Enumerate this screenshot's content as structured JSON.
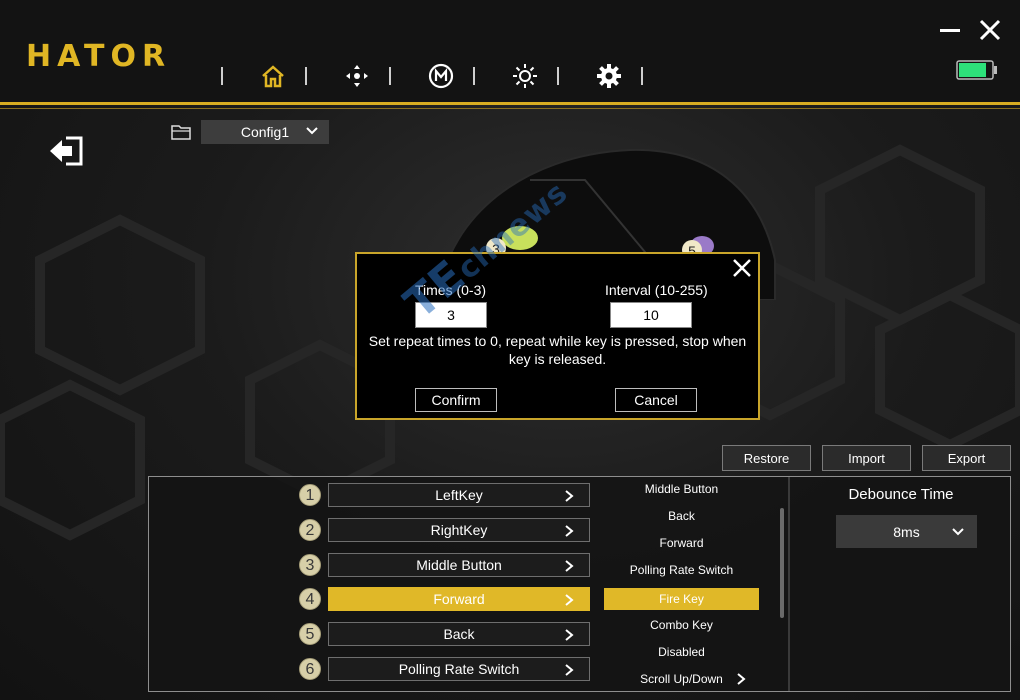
{
  "app": {
    "logo_text": "HATOR"
  },
  "nav": {
    "icons": [
      "home-icon",
      "directional-pad-icon",
      "macro-icon",
      "lighting-icon",
      "settings-icon"
    ],
    "active": "home-icon",
    "active_color": "#e0b624"
  },
  "window": {
    "minimize_icon": "minimize-icon",
    "close_icon": "close-icon",
    "battery_color": "#2de07a"
  },
  "config": {
    "selected": "Config1"
  },
  "dialog": {
    "times_label": "Times (0-3)",
    "times_value": "3",
    "interval_label": "Interval (10-255)",
    "interval_value": "10",
    "message_line1": "Set repeat times to 0, repeat while key is pressed, stop when",
    "message_line2": "key is released.",
    "confirm_label": "Confirm",
    "cancel_label": "Cancel"
  },
  "watermark": {
    "text": "TE",
    "suffix": "chnews"
  },
  "actions": {
    "restore": "Restore",
    "import": "Import",
    "export": "Export"
  },
  "keys": [
    {
      "number": "1",
      "label": "LeftKey",
      "active": false
    },
    {
      "number": "2",
      "label": "RightKey",
      "active": false
    },
    {
      "number": "3",
      "label": "Middle Button",
      "active": false
    },
    {
      "number": "4",
      "label": "Forward",
      "active": true
    },
    {
      "number": "5",
      "label": "Back",
      "active": false
    },
    {
      "number": "6",
      "label": "Polling Rate Switch",
      "active": false
    }
  ],
  "options": [
    {
      "label": "Middle Button",
      "active": false
    },
    {
      "label": "Back",
      "active": false
    },
    {
      "label": "Forward",
      "active": false
    },
    {
      "label": "Polling Rate Switch",
      "active": false
    },
    {
      "label": "Fire Key",
      "active": true
    },
    {
      "label": "Combo Key",
      "active": false
    },
    {
      "label": "Disabled",
      "active": false
    },
    {
      "label": "Scroll Up/Down",
      "active": false
    }
  ],
  "debounce": {
    "title": "Debounce Time",
    "value": "8ms"
  },
  "mouse_labels": {
    "button3": "3",
    "button5": "5"
  },
  "colors": {
    "accent": "#e0b828",
    "dialog_border": "#c9a52a"
  }
}
